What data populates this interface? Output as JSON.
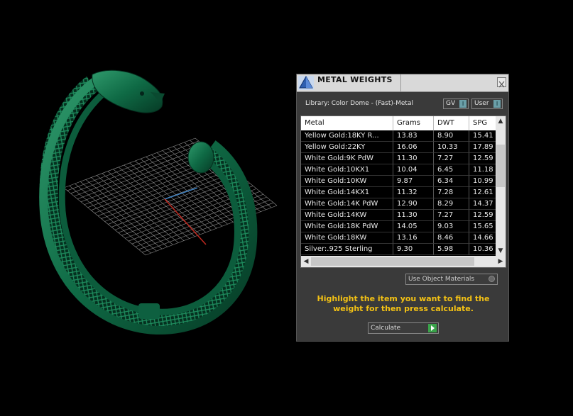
{
  "window": {
    "title": "METAL WEIGHTS",
    "close_icon": "close-icon",
    "app_icon": "pyramid-icon"
  },
  "library_label": "Library: Color Dome - (Fast)-Metal",
  "toggles": {
    "gv_label": "GV",
    "user_label": "User",
    "knob_glyph": "I"
  },
  "table": {
    "columns": [
      "Metal",
      "Grams",
      "DWT",
      "SPG"
    ],
    "rows": [
      [
        "Yellow Gold:18KY R...",
        "13.83",
        "8.90",
        "15.41"
      ],
      [
        "Yellow Gold:22KY",
        "16.06",
        "10.33",
        "17.89"
      ],
      [
        "White Gold:9K PdW",
        "11.30",
        "7.27",
        "12.59"
      ],
      [
        "White Gold:10KX1",
        "10.04",
        "6.45",
        "11.18"
      ],
      [
        "White Gold:10KW",
        "9.87",
        "6.34",
        "10.99"
      ],
      [
        "White Gold:14KX1",
        "11.32",
        "7.28",
        "12.61"
      ],
      [
        "White Gold:14K PdW",
        "12.90",
        "8.29",
        "14.37"
      ],
      [
        "White Gold:14KW",
        "11.30",
        "7.27",
        "12.59"
      ],
      [
        "White Gold:18K PdW",
        "14.05",
        "9.03",
        "15.65"
      ],
      [
        "White Gold:18KW",
        "13.16",
        "8.46",
        "14.66"
      ],
      [
        "Silver:.925 Sterling",
        "9.30",
        "5.98",
        "10.36"
      ]
    ]
  },
  "use_object_materials": "Use Object Materials",
  "hint": "Highlight the item you want to find the weight for then press calculate.",
  "calculate_label": "Calculate",
  "colors": {
    "model_green": "#0f6a45",
    "hint_yellow": "#f4c214",
    "panel_bg": "#3a3a3a"
  }
}
